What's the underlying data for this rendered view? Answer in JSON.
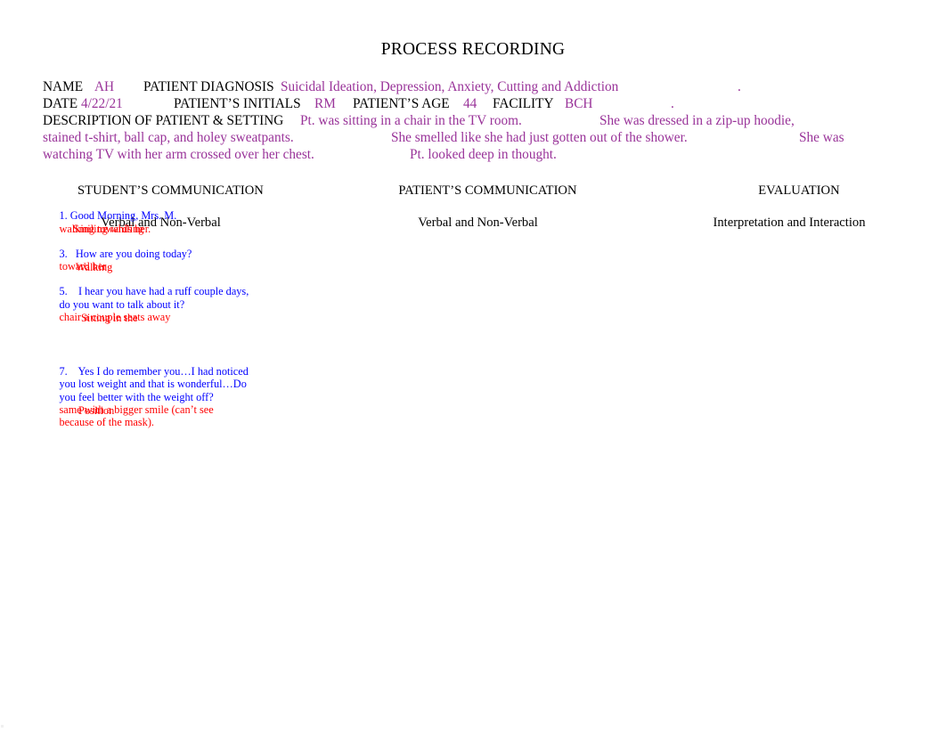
{
  "document": {
    "title": "PROCESS RECORDING"
  },
  "header": {
    "name_label": "NAME",
    "name_value": "AH",
    "diagnosis_label": "PATIENT DIAGNOSIS",
    "diagnosis_value": "Suicidal Ideation, Depression, Anxiety, Cutting and Addiction",
    "diagnosis_trailing_period": ".",
    "date_label": "DATE",
    "date_value": "4/22/21",
    "initials_label": "PATIENT’S INITIALS",
    "initials_value": "RM",
    "age_label": "PATIENT’S AGE",
    "age_value": "44",
    "facility_label": "FACILITY",
    "facility_value": "BCH",
    "facility_trailing_period": ".",
    "description_label": "DESCRIPTION OF PATIENT & SETTING",
    "description_seg_1": "Pt. was sitting in a chair in the TV room.",
    "description_seg_2": "She was dressed in a zip-up hoodie,",
    "description_seg_3": "stained t-shirt, ball cap, and holey sweatpants.",
    "description_seg_4": "She smelled like she had just gotten out of the shower.",
    "description_seg_5": "She was",
    "description_seg_6": "watching TV with her arm crossed over her chest.",
    "description_seg_7": "Pt. looked deep in thought."
  },
  "columns": [
    {
      "title": "STUDENT’S COMMUNICATION",
      "subtitle": "Verbal and Non-Verbal"
    },
    {
      "title": "PATIENT’S COMMUNICATION",
      "subtitle": "Verbal and Non-Verbal"
    },
    {
      "title": "EVALUATION",
      "subtitle": "Interpretation and Interaction"
    }
  ],
  "entries": [
    {
      "number": "1.",
      "verbal": "1. Good Morning, Mrs. M.",
      "nonverbal_inline": "Smiling whiling",
      "nonverbal_rest": "walking towards her."
    },
    {
      "number": "3.",
      "verbal": "3.   How are you doing today?",
      "nonverbal_inline": "Walking",
      "nonverbal_rest": "toward her"
    },
    {
      "number": "5.",
      "verbal_line1": "5.    I hear you have had a ruff couple days,",
      "verbal_line2": "do you want to talk about it?",
      "nonverbal_inline": "Sitting in the",
      "nonverbal_rest": "chair a couple seats away"
    },
    {
      "number": "7.",
      "verbal_line1": "7.    Yes I do remember you…I had noticed",
      "verbal_line2": "you lost weight and that is wonderful…Do",
      "verbal_line3": "you feel better with the weight off?",
      "nonverbal_inline": "Position",
      "nonverbal_rest_line1": "same with a bigger smile (can’t see",
      "nonverbal_rest_line2": "because of the mask)."
    }
  ],
  "colors": {
    "label_black": "#000000",
    "fill_purple": "#993399",
    "student_verbal_blue": "#0000ff",
    "student_nonverbal_red": "#ff0000",
    "page_background": "#ffffff"
  }
}
